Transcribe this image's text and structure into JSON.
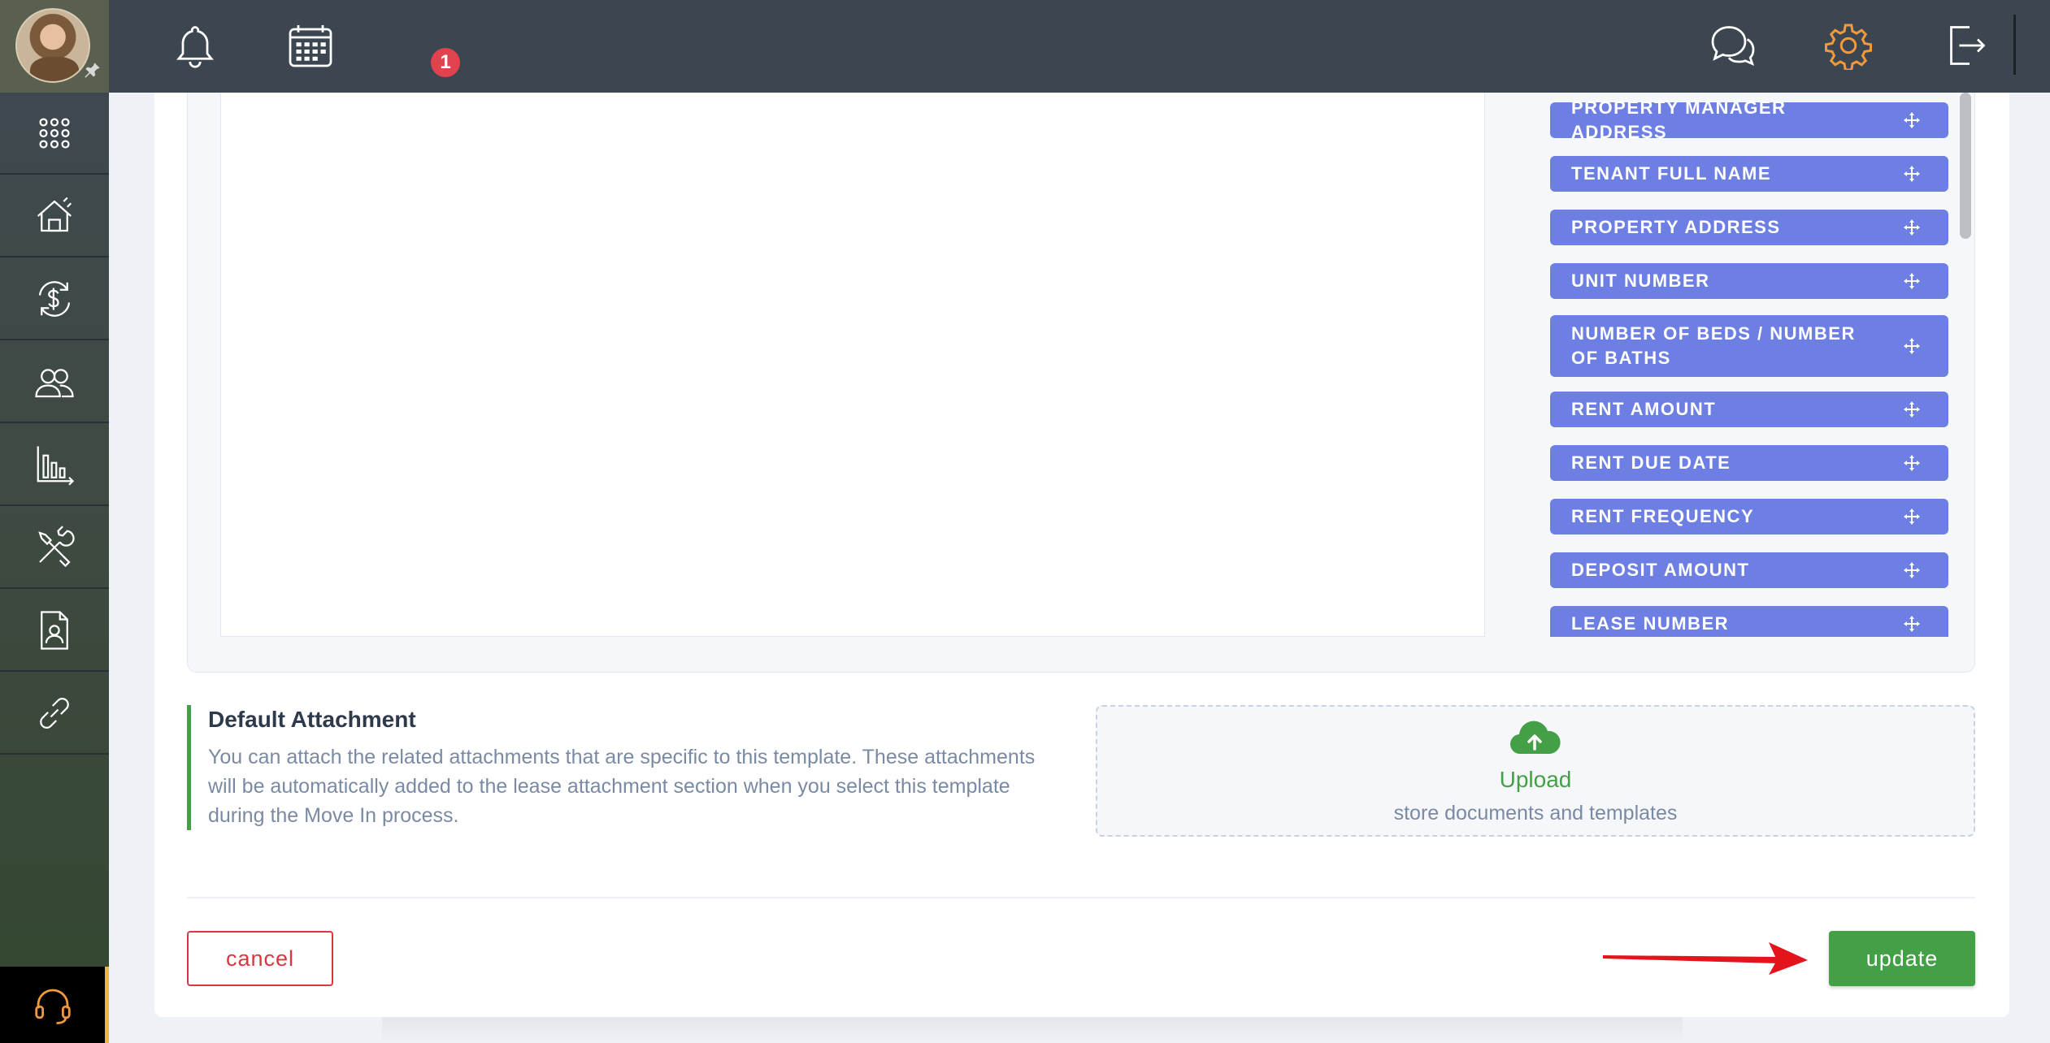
{
  "header": {
    "calendar_badge": "1"
  },
  "sidebar": {
    "items": [
      {
        "name": "apps-grid-icon"
      },
      {
        "name": "property-house-icon"
      },
      {
        "name": "accounting-dollar-icon"
      },
      {
        "name": "contacts-people-icon"
      },
      {
        "name": "reports-chart-icon"
      },
      {
        "name": "maintenance-tools-icon"
      },
      {
        "name": "documents-icon"
      },
      {
        "name": "integrations-link-icon"
      }
    ]
  },
  "template_tags": {
    "items": [
      "PROPERTY MANAGER ADDRESS",
      "TENANT FULL NAME",
      "PROPERTY ADDRESS",
      "UNIT NUMBER",
      "NUMBER OF BEDS / NUMBER OF BATHS",
      "RENT AMOUNT",
      "RENT DUE DATE",
      "RENT FREQUENCY",
      "DEPOSIT AMOUNT",
      "LEASE NUMBER"
    ]
  },
  "attachment": {
    "title": "Default Attachment",
    "description": "You can attach the related attachments that are specific to this template. These attachments will be automatically added to the lease attachment section when you select this template during the Move In process.",
    "upload_label": "Upload",
    "upload_sub": "store documents and templates"
  },
  "actions": {
    "cancel_label": "cancel",
    "update_label": "update"
  },
  "colors": {
    "tag_bg": "#6d7fe3",
    "accent_green": "#43a047",
    "cancel_red": "#d9373f",
    "settings_orange": "#f29a3b",
    "arrow_red": "#e3141b"
  }
}
